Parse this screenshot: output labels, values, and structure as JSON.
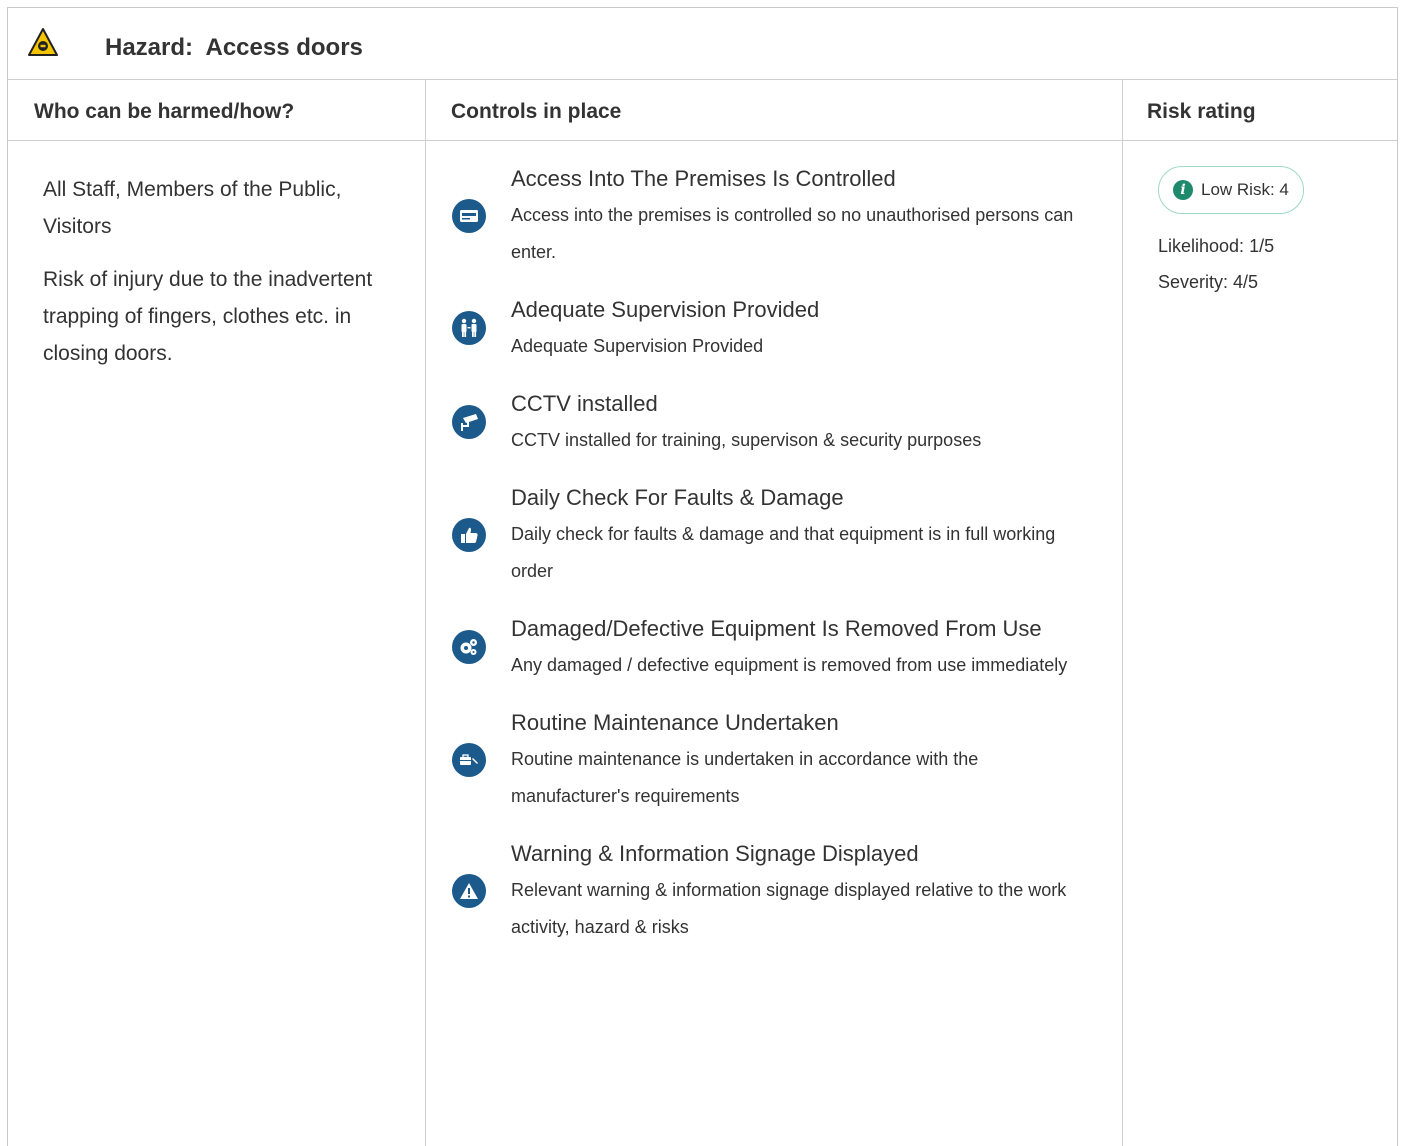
{
  "hazard": {
    "label": "Hazard:",
    "name": "Access doors"
  },
  "columns": {
    "who": "Who can be harmed/how?",
    "controls": "Controls in place",
    "risk": "Risk rating"
  },
  "who": {
    "people": "All Staff, Members of the Public, Visitors",
    "description": "Risk of injury due to the inadvertent trapping of fingers, clothes etc. in closing doors."
  },
  "controls": [
    {
      "icon": "pass-card-icon",
      "title": "Access Into The Premises Is Controlled",
      "description": "Access into the premises is controlled so no unauthorised persons can enter."
    },
    {
      "icon": "supervision-icon",
      "title": "Adequate Supervision Provided",
      "description": "Adequate Supervision Provided"
    },
    {
      "icon": "cctv-camera-icon",
      "title": "CCTV installed",
      "description": "CCTV installed for training, supervison & security purposes"
    },
    {
      "icon": "thumbs-up-icon",
      "title": "Daily Check For Faults & Damage",
      "description": "Daily check for faults & damage and that equipment is in full working order"
    },
    {
      "icon": "cogs-icon",
      "title": "Damaged/Defective Equipment Is Removed From Use",
      "description": "Any damaged / defective equipment is removed from use immediately"
    },
    {
      "icon": "toolbox-icon",
      "title": "Routine Maintenance Undertaken",
      "description": "Routine maintenance is undertaken in accordance with the manufacturer's requirements"
    },
    {
      "icon": "warning-sign-icon",
      "title": "Warning & Information Signage Displayed",
      "description": "Relevant warning & information signage displayed relative to the work activity, hazard & risks"
    }
  ],
  "risk": {
    "badge": "Low Risk: 4",
    "likelihood": "Likelihood: 1/5",
    "severity": "Severity: 4/5"
  },
  "colors": {
    "icon_blue": "#1d5a8c",
    "risk_green": "#1f8a6b",
    "badge_border": "#9fd8c8",
    "hazard_yellow": "#f5c400"
  }
}
